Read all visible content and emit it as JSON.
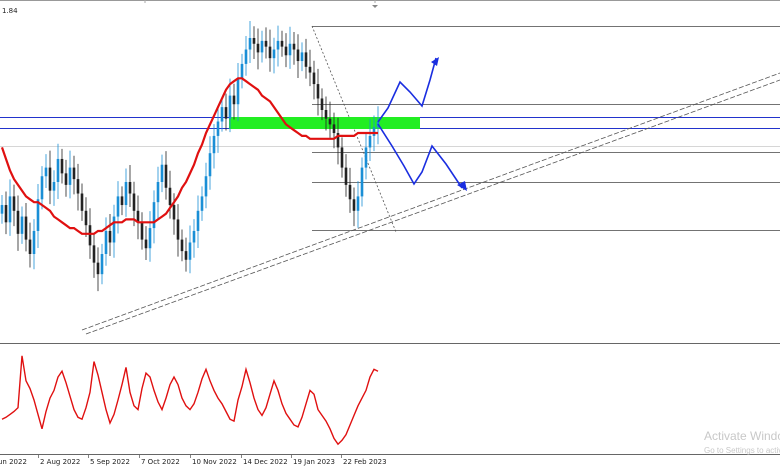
{
  "chart_data": {
    "type": "line",
    "corner_label": "1.84",
    "x_tick_labels": [
      "un 2022",
      "2 Aug 2022",
      "5 Sep 2022",
      "7 Oct 2022",
      "10 Nov 2022",
      "14 Dec 2022",
      "19 Jan 2023",
      "22 Feb 2023"
    ],
    "price_series": {
      "color": "#1a8fd6",
      "closes": [
        0.42,
        0.36,
        0.45,
        0.4,
        0.32,
        0.38,
        0.3,
        0.25,
        0.33,
        0.44,
        0.52,
        0.55,
        0.47,
        0.5,
        0.58,
        0.53,
        0.49,
        0.55,
        0.51,
        0.46,
        0.4,
        0.35,
        0.28,
        0.22,
        0.18,
        0.25,
        0.33,
        0.29,
        0.38,
        0.45,
        0.42,
        0.5,
        0.46,
        0.4,
        0.36,
        0.3,
        0.27,
        0.34,
        0.43,
        0.5,
        0.56,
        0.48,
        0.42,
        0.37,
        0.3,
        0.26,
        0.23,
        0.29,
        0.33,
        0.4,
        0.45,
        0.52,
        0.6,
        0.66,
        0.71,
        0.76,
        0.72,
        0.8,
        0.77,
        0.86,
        0.91,
        0.96,
        1.0,
        0.98,
        0.95,
        0.99,
        0.97,
        0.93,
        0.96,
        0.99,
        0.97,
        0.94,
        0.98,
        0.96,
        0.92,
        0.95,
        0.9,
        0.88,
        0.84,
        0.79,
        0.75,
        0.72,
        0.7,
        0.67,
        0.62,
        0.55,
        0.49,
        0.44,
        0.4,
        0.45,
        0.55,
        0.62,
        0.66,
        0.69,
        0.71
      ]
    },
    "moving_average": {
      "color": "#e01010",
      "values": [
        0.62,
        0.58,
        0.54,
        0.51,
        0.49,
        0.47,
        0.45,
        0.44,
        0.43,
        0.43,
        0.42,
        0.41,
        0.4,
        0.38,
        0.37,
        0.36,
        0.35,
        0.34,
        0.34,
        0.33,
        0.32,
        0.32,
        0.32,
        0.32,
        0.33,
        0.33,
        0.34,
        0.35,
        0.36,
        0.36,
        0.36,
        0.37,
        0.37,
        0.37,
        0.36,
        0.36,
        0.36,
        0.36,
        0.36,
        0.37,
        0.38,
        0.39,
        0.41,
        0.43,
        0.45,
        0.48,
        0.5,
        0.53,
        0.56,
        0.6,
        0.63,
        0.67,
        0.7,
        0.73,
        0.76,
        0.79,
        0.82,
        0.84,
        0.85,
        0.86,
        0.86,
        0.85,
        0.84,
        0.83,
        0.82,
        0.8,
        0.79,
        0.78,
        0.76,
        0.74,
        0.72,
        0.7,
        0.69,
        0.68,
        0.67,
        0.66,
        0.66,
        0.65,
        0.65,
        0.65,
        0.65,
        0.65,
        0.65,
        0.65,
        0.66,
        0.66,
        0.66,
        0.66,
        0.66,
        0.67,
        0.67,
        0.67,
        0.67,
        0.67,
        0.67
      ]
    },
    "oscillator": {
      "color": "#e01010",
      "values": [
        0.3,
        0.32,
        0.35,
        0.38,
        0.42,
        0.96,
        0.7,
        0.62,
        0.5,
        0.35,
        0.2,
        0.38,
        0.52,
        0.6,
        0.74,
        0.8,
        0.68,
        0.54,
        0.4,
        0.32,
        0.3,
        0.42,
        0.58,
        0.9,
        0.76,
        0.58,
        0.4,
        0.26,
        0.35,
        0.5,
        0.66,
        0.84,
        0.58,
        0.44,
        0.4,
        0.62,
        0.78,
        0.74,
        0.6,
        0.48,
        0.4,
        0.52,
        0.66,
        0.74,
        0.66,
        0.52,
        0.44,
        0.4,
        0.46,
        0.58,
        0.72,
        0.82,
        0.7,
        0.6,
        0.52,
        0.46,
        0.38,
        0.3,
        0.28,
        0.5,
        0.64,
        0.82,
        0.68,
        0.52,
        0.4,
        0.34,
        0.42,
        0.56,
        0.7,
        0.6,
        0.46,
        0.36,
        0.3,
        0.24,
        0.22,
        0.32,
        0.46,
        0.6,
        0.56,
        0.4,
        0.34,
        0.28,
        0.2,
        0.1,
        0.04,
        0.08,
        0.14,
        0.24,
        0.34,
        0.44,
        0.52,
        0.6,
        0.74,
        0.82,
        0.8
      ]
    },
    "support_zone_color": "#22ee22",
    "horizontal_level_color": "#2233cc",
    "projection_color": "#1a2ee0",
    "grid": false,
    "watermark_line1": "Activate Windo",
    "watermark_line2": "Go to Settings to activate Wi"
  }
}
